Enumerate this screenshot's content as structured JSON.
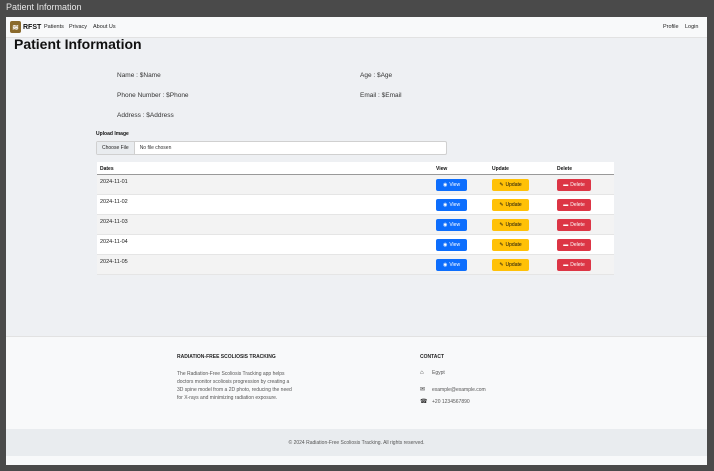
{
  "window": {
    "title": "Patient Information"
  },
  "navbar": {
    "brand": "RFST",
    "links": [
      "Patients",
      "Privacy",
      "About Us"
    ],
    "right_links": [
      "Profile",
      "Login"
    ]
  },
  "page": {
    "title": "Patient Information"
  },
  "patient": {
    "name": "Name : $Name",
    "age": "Age : $Age",
    "phone": "Phone Number : $Phone",
    "email": "Email : $Email",
    "address": "Address : $Address"
  },
  "upload": {
    "label": "Upload Image",
    "button": "Choose File",
    "status": "No file chosen"
  },
  "table": {
    "headers": [
      "Dates",
      "View",
      "Update",
      "Delete"
    ],
    "rows": [
      {
        "date": "2024-11-01"
      },
      {
        "date": "2024-11-02"
      },
      {
        "date": "2024-11-03"
      },
      {
        "date": "2024-11-04"
      },
      {
        "date": "2024-11-05"
      }
    ],
    "view_label": "View",
    "update_label": "Update",
    "delete_label": "Delete"
  },
  "footer": {
    "about_title": "RADIATION-FREE SCOLIOSIS TRACKING",
    "about_text": "The Radiation-Free Scoliosis Tracking app helps doctors monitor scoliosis progression by creating a 3D spine model from a 2D photo, reducing the need for X-rays and minimizing radiation exposure.",
    "contact_title": "CONTACT",
    "contact_location": "Egypt",
    "contact_email": "example@example.com",
    "contact_phone": "+20 1234567890",
    "copyright": "© 2024 Radiation-Free Scoliosis Tracking. All rights reserved."
  },
  "icons": {
    "view": "eye-icon",
    "update": "edit-icon",
    "delete": "trash-icon",
    "location": "home-icon",
    "email": "envelope-icon",
    "phone": "phone-icon"
  },
  "colors": {
    "view": "#0d6efd",
    "update": "#ffc107",
    "delete": "#dc3545"
  }
}
